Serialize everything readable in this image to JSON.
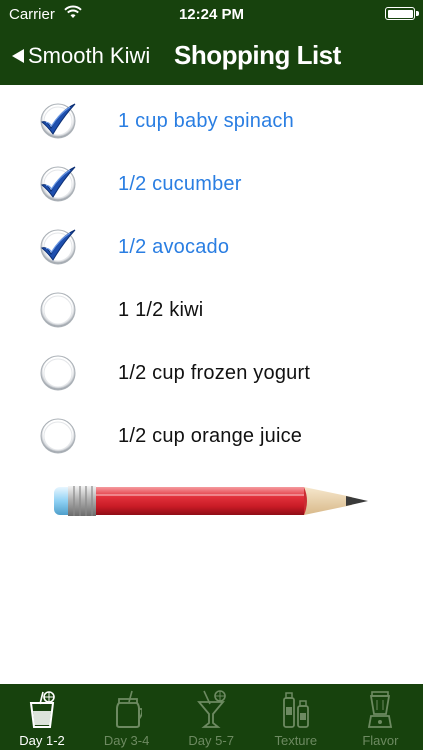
{
  "status_bar": {
    "carrier": "Carrier",
    "time": "12:24 PM",
    "icons": [
      "wifi-icon",
      "battery-icon"
    ]
  },
  "nav": {
    "back_label": "Smooth Kiwi",
    "title": "Shopping List"
  },
  "shopping_list": {
    "items": [
      {
        "label": "1 cup baby spinach",
        "checked": true
      },
      {
        "label": "1/2 cucumber",
        "checked": true
      },
      {
        "label": "1/2 avocado",
        "checked": true
      },
      {
        "label": "1 1/2 kiwi",
        "checked": false
      },
      {
        "label": "1/2 cup frozen yogurt",
        "checked": false
      },
      {
        "label": "1/2 cup orange juice",
        "checked": false
      }
    ]
  },
  "tab_bar": {
    "tabs": [
      {
        "label": "Day 1-2",
        "icon": "glass-with-lime-icon",
        "active": true
      },
      {
        "label": "Day 3-4",
        "icon": "mason-jar-icon",
        "active": false
      },
      {
        "label": "Day 5-7",
        "icon": "cocktail-glass-icon",
        "active": false
      },
      {
        "label": "Texture",
        "icon": "bottles-icon",
        "active": false
      },
      {
        "label": "Flavor",
        "icon": "blender-icon",
        "active": false
      }
    ]
  },
  "colors": {
    "header_bg": "#17420d",
    "checked_text": "#2a7ee2",
    "unchecked_text": "#111111",
    "tab_active": "#ffffff",
    "tab_inactive": "#6d8a61"
  }
}
